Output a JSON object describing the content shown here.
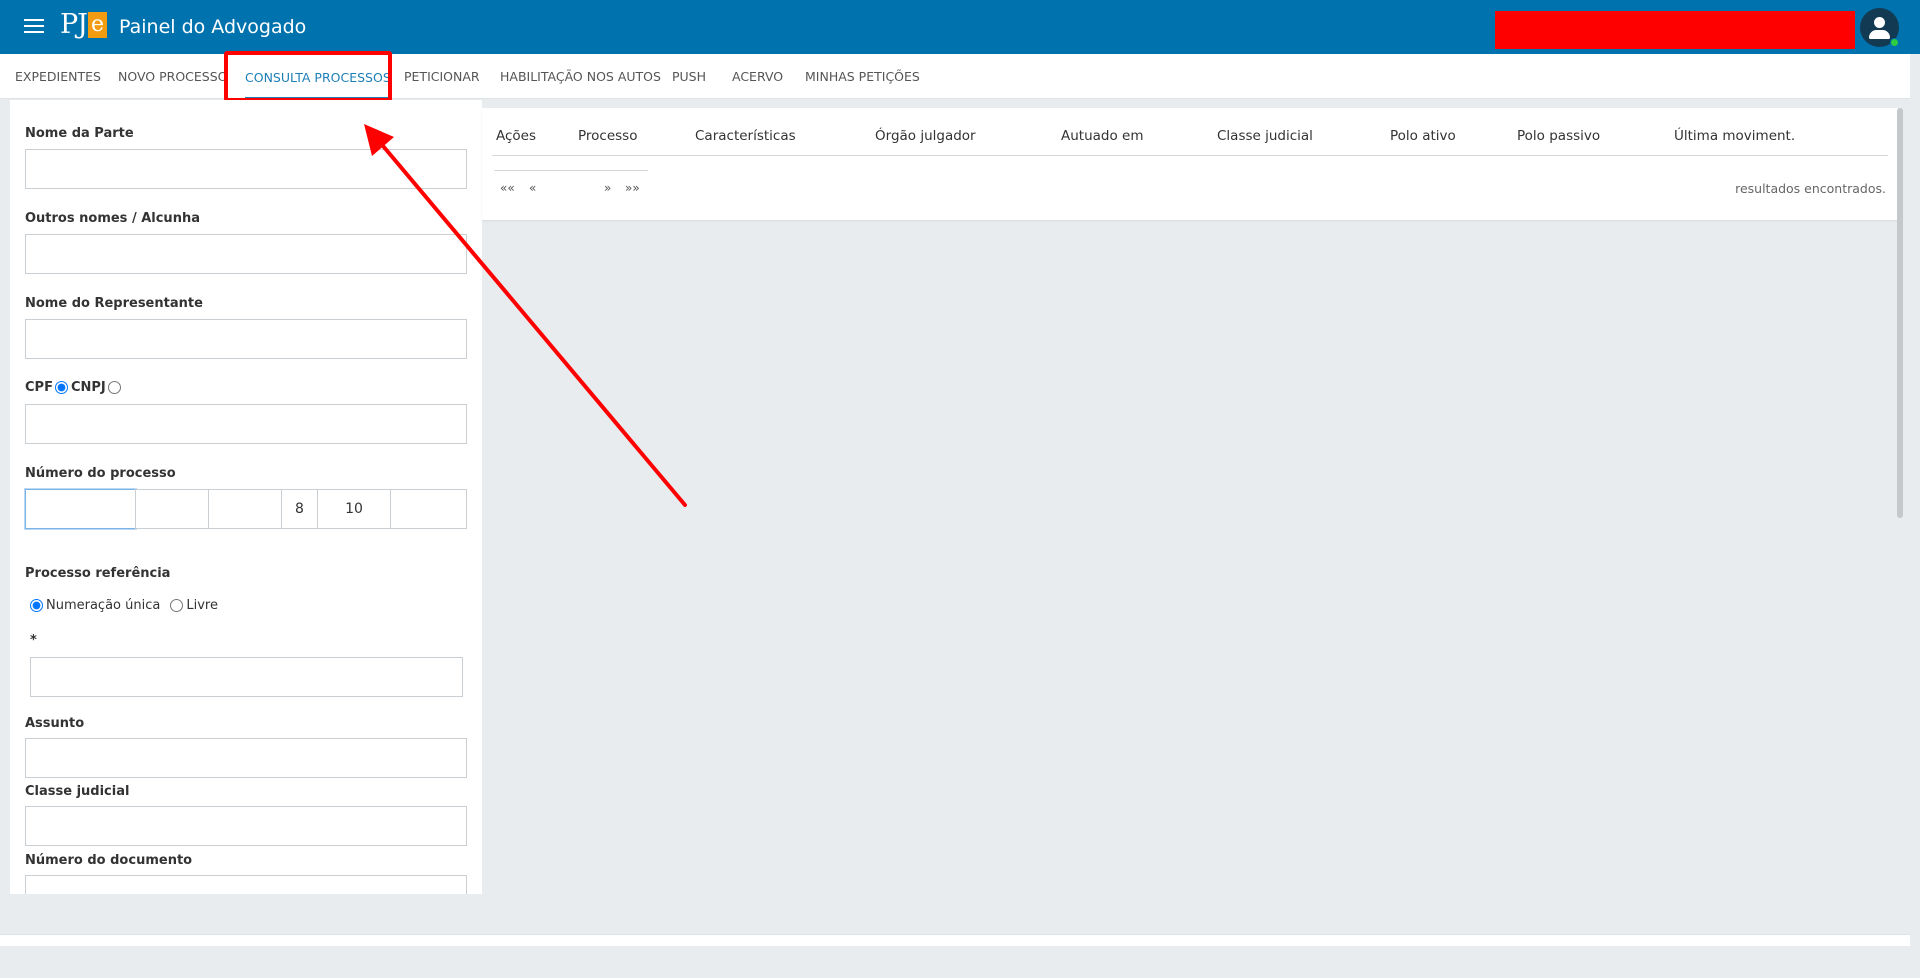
{
  "header": {
    "logo_pj": "PJ",
    "logo_e": "e",
    "title": "Painel do Advogado"
  },
  "tabs": [
    {
      "label": "EXPEDIENTES"
    },
    {
      "label": "NOVO PROCESSO"
    },
    {
      "label": "CONSULTA PROCESSOS"
    },
    {
      "label": "PETICIONAR"
    },
    {
      "label": "HABILITAÇÃO NOS AUTOS"
    },
    {
      "label": "PUSH"
    },
    {
      "label": "ACERVO"
    },
    {
      "label": "MINHAS PETIÇÕES"
    }
  ],
  "active_tab": "CONSULTA PROCESSOS",
  "form": {
    "nome_parte_label": "Nome da Parte",
    "outros_nomes_label": "Outros nomes / Alcunha",
    "nome_representante_label": "Nome do Representante",
    "cpf_label": "CPF",
    "cnpj_label": "CNPJ",
    "numero_processo_label": "Número do processo",
    "numero_processo": {
      "seq": "",
      "dv": "",
      "ano": "",
      "segmento": "8",
      "tribunal": "10",
      "origem": ""
    },
    "processo_referencia_label": "Processo referência",
    "numeracao_unica_label": "Numeração única",
    "livre_label": "Livre",
    "required_mark": "*",
    "assunto_label": "Assunto",
    "classe_judicial_label": "Classe judicial",
    "numero_documento_label": "Número do documento"
  },
  "results": {
    "columns": [
      "Ações",
      "Processo",
      "Características",
      "Órgão julgador",
      "Autuado em",
      "Classe judicial",
      "Polo ativo",
      "Polo passivo",
      "Última moviment."
    ],
    "pager": {
      "first": "««",
      "prev": "«",
      "next": "»",
      "last": "»»"
    },
    "found_text": "resultados encontrados."
  },
  "colors": {
    "header_bg": "#0073ae",
    "active_tab": "#1d7fb7",
    "highlight": "#ff0000",
    "logo_e": "#f39c12"
  },
  "icons": [
    "hamburger-menu-icon",
    "user-avatar-icon",
    "online-status-icon"
  ]
}
